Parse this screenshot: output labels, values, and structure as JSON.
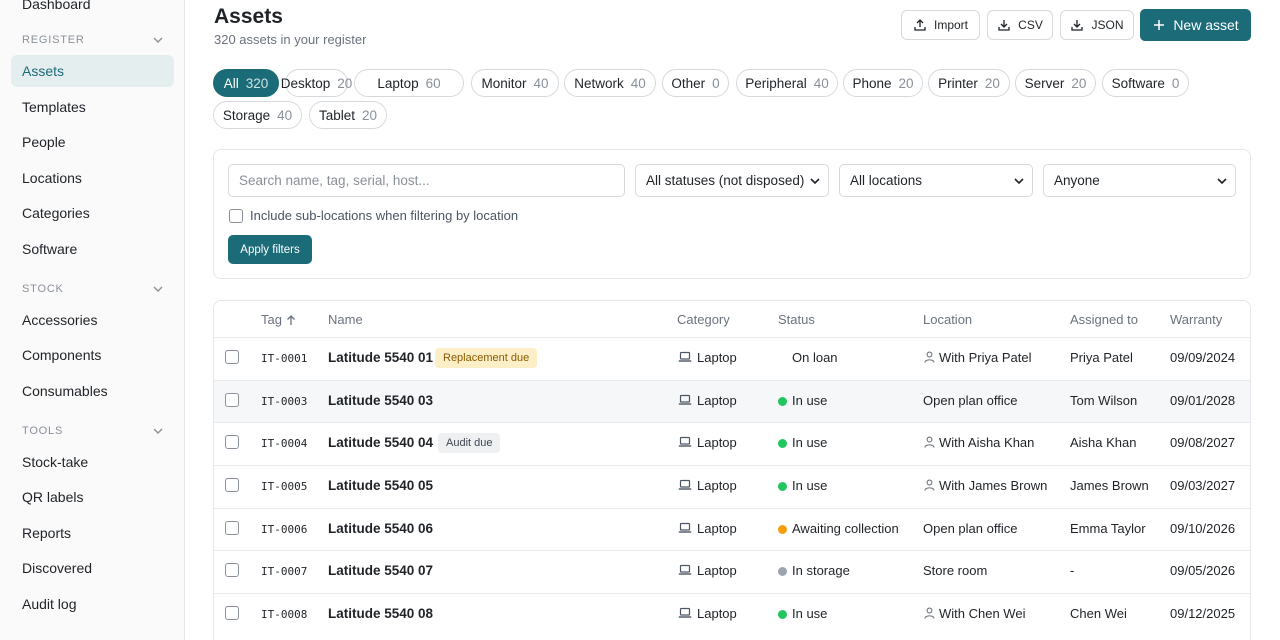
{
  "sidebar": {
    "top_partial": "Dashboard",
    "sections": [
      {
        "title": "REGISTER",
        "items": [
          "Assets",
          "Templates",
          "People",
          "Locations",
          "Categories",
          "Software"
        ]
      },
      {
        "title": "STOCK",
        "items": [
          "Accessories",
          "Components",
          "Consumables"
        ]
      },
      {
        "title": "TOOLS",
        "items": [
          "Stock-take",
          "QR labels",
          "Reports",
          "Discovered",
          "Audit log"
        ]
      }
    ],
    "active_item": "Assets"
  },
  "header": {
    "title": "Assets",
    "subtitle": "320 assets in your register",
    "buttons": {
      "import": "Import",
      "csv": "CSV",
      "json": "JSON",
      "new_asset": "New asset"
    }
  },
  "categories": [
    {
      "label": "All",
      "count": "320",
      "active": true
    },
    {
      "label": "Desktop",
      "count": "20"
    },
    {
      "label": "Laptop",
      "count": "60"
    },
    {
      "label": "Monitor",
      "count": "40"
    },
    {
      "label": "Network",
      "count": "40"
    },
    {
      "label": "Other",
      "count": "0"
    },
    {
      "label": "Peripheral",
      "count": "40"
    },
    {
      "label": "Phone",
      "count": "20"
    },
    {
      "label": "Printer",
      "count": "20"
    },
    {
      "label": "Server",
      "count": "20"
    },
    {
      "label": "Software",
      "count": "0"
    },
    {
      "label": "Storage",
      "count": "40"
    },
    {
      "label": "Tablet",
      "count": "20"
    }
  ],
  "filters": {
    "search_placeholder": "Search name, tag, serial, host...",
    "status": "All statuses (not disposed)",
    "location": "All locations",
    "assignee": "Anyone",
    "sublocations_label": "Include sub-locations when filtering by location",
    "apply_label": "Apply filters"
  },
  "table": {
    "columns": {
      "tag": "Tag",
      "name": "Name",
      "category": "Category",
      "status": "Status",
      "location": "Location",
      "assigned": "Assigned to",
      "warranty": "Warranty"
    },
    "sort_icon": "arrow-up-icon",
    "rows": [
      {
        "tag": "IT-0001",
        "name": "Latitude 5540 01",
        "badge": "Replacement due",
        "badge_kind": "replacement",
        "category": "Laptop",
        "status": "On loan",
        "status_color": "",
        "location": "With Priya Patel",
        "location_person": true,
        "assigned": "Priya Patel",
        "warranty": "09/09/2024"
      },
      {
        "tag": "IT-0003",
        "name": "Latitude 5540 03",
        "badge": "",
        "category": "Laptop",
        "status": "In use",
        "status_color": "#22c55e",
        "location": "Open plan office",
        "location_person": false,
        "assigned": "Tom Wilson",
        "warranty": "09/01/2028"
      },
      {
        "tag": "IT-0004",
        "name": "Latitude 5540 04",
        "badge": "Audit due",
        "badge_kind": "audit",
        "category": "Laptop",
        "status": "In use",
        "status_color": "#22c55e",
        "location": "With Aisha Khan",
        "location_person": true,
        "assigned": "Aisha Khan",
        "warranty": "09/08/2027"
      },
      {
        "tag": "IT-0005",
        "name": "Latitude 5540 05",
        "badge": "",
        "category": "Laptop",
        "status": "In use",
        "status_color": "#22c55e",
        "location": "With James Brown",
        "location_person": true,
        "assigned": "James Brown",
        "warranty": "09/03/2027"
      },
      {
        "tag": "IT-0006",
        "name": "Latitude 5540 06",
        "badge": "",
        "category": "Laptop",
        "status": "Awaiting collection",
        "status_color": "#f59e0b",
        "location": "Open plan office",
        "location_person": false,
        "assigned": "Emma Taylor",
        "warranty": "09/10/2026"
      },
      {
        "tag": "IT-0007",
        "name": "Latitude 5540 07",
        "badge": "",
        "category": "Laptop",
        "status": "In storage",
        "status_color": "#9ca3af",
        "location": "Store room",
        "location_person": false,
        "assigned": "-",
        "warranty": "09/05/2026"
      },
      {
        "tag": "IT-0008",
        "name": "Latitude 5540 08",
        "badge": "",
        "category": "Laptop",
        "status": "In use",
        "status_color": "#22c55e",
        "location": "With Chen Wei",
        "location_person": true,
        "assigned": "Chen Wei",
        "warranty": "09/12/2025"
      }
    ]
  }
}
